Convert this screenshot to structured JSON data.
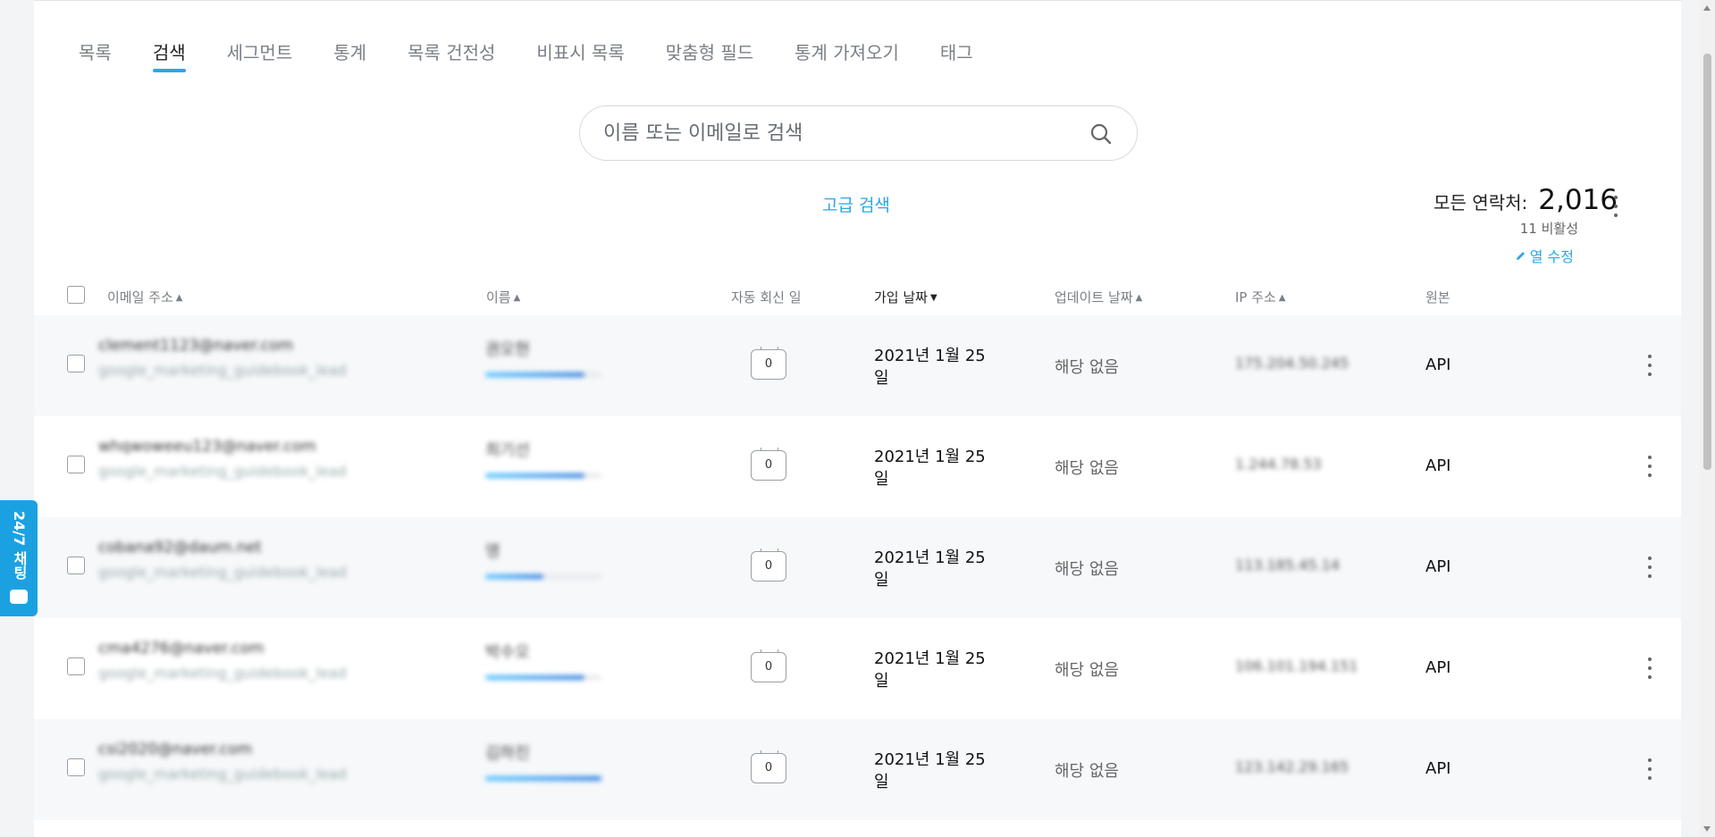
{
  "tabs": [
    {
      "label": "목록",
      "active": false
    },
    {
      "label": "검색",
      "active": true
    },
    {
      "label": "세그먼트",
      "active": false
    },
    {
      "label": "통계",
      "active": false
    },
    {
      "label": "목록 건전성",
      "active": false
    },
    {
      "label": "비표시 목록",
      "active": false
    },
    {
      "label": "맞춤형 필드",
      "active": false
    },
    {
      "label": "통계 가져오기",
      "active": false
    },
    {
      "label": "태그",
      "active": false
    }
  ],
  "search": {
    "placeholder": "이름 또는 이메일로 검색",
    "icon": "search-icon"
  },
  "advanced_search": "고급 검색",
  "summary": {
    "label": "모든 연락처:",
    "count": "2,016",
    "inactive": "11 비활성",
    "edit_columns": "열 수정"
  },
  "columns": {
    "email": "이메일 주소",
    "name": "이름",
    "autoreply": "자동 회신 일",
    "joined": "가입 날짜",
    "updated": "업데이트 날짜",
    "ip": "IP 주소",
    "source": "원본"
  },
  "rows": [
    {
      "email": "clement1123@naver.com",
      "list": "google_marketing_guidebook_lead",
      "name": "권오현",
      "score": 0.85,
      "autoreply": "0",
      "joined": "2021년 1월 25일",
      "updated": "해당 없음",
      "ip": "175.204.50.245",
      "source": "API"
    },
    {
      "email": "whqwoweeu123@naver.com",
      "list": "google_marketing_guidebook_lead",
      "name": "최기선",
      "score": 0.85,
      "autoreply": "0",
      "joined": "2021년 1월 25일",
      "updated": "해당 없음",
      "ip": "1.244.78.53",
      "source": "API"
    },
    {
      "email": "cobana92@daum.net",
      "list": "google_marketing_guidebook_lead",
      "name": "영",
      "score": 0.5,
      "autoreply": "0",
      "joined": "2021년 1월 25일",
      "updated": "해당 없음",
      "ip": "113.185.45.14",
      "source": "API"
    },
    {
      "email": "cma4276@naver.com",
      "list": "google_marketing_guidebook_lead",
      "name": "박수오",
      "score": 0.85,
      "autoreply": "0",
      "joined": "2021년 1월 25일",
      "updated": "해당 없음",
      "ip": "106.101.194.151",
      "source": "API"
    },
    {
      "email": "csi2020@naver.com",
      "list": "google_marketing_guidebook_lead",
      "name": "김하진",
      "score": 1.0,
      "autoreply": "0",
      "joined": "2021년 1월 25일",
      "updated": "해당 없음",
      "ip": "123.142.29.165",
      "source": "API"
    }
  ],
  "chat_widget": "24/7 채팅",
  "colors": {
    "accent": "#2aa7e6",
    "chat": "#1ba1e2",
    "row_alt": "#f6f8fa"
  }
}
